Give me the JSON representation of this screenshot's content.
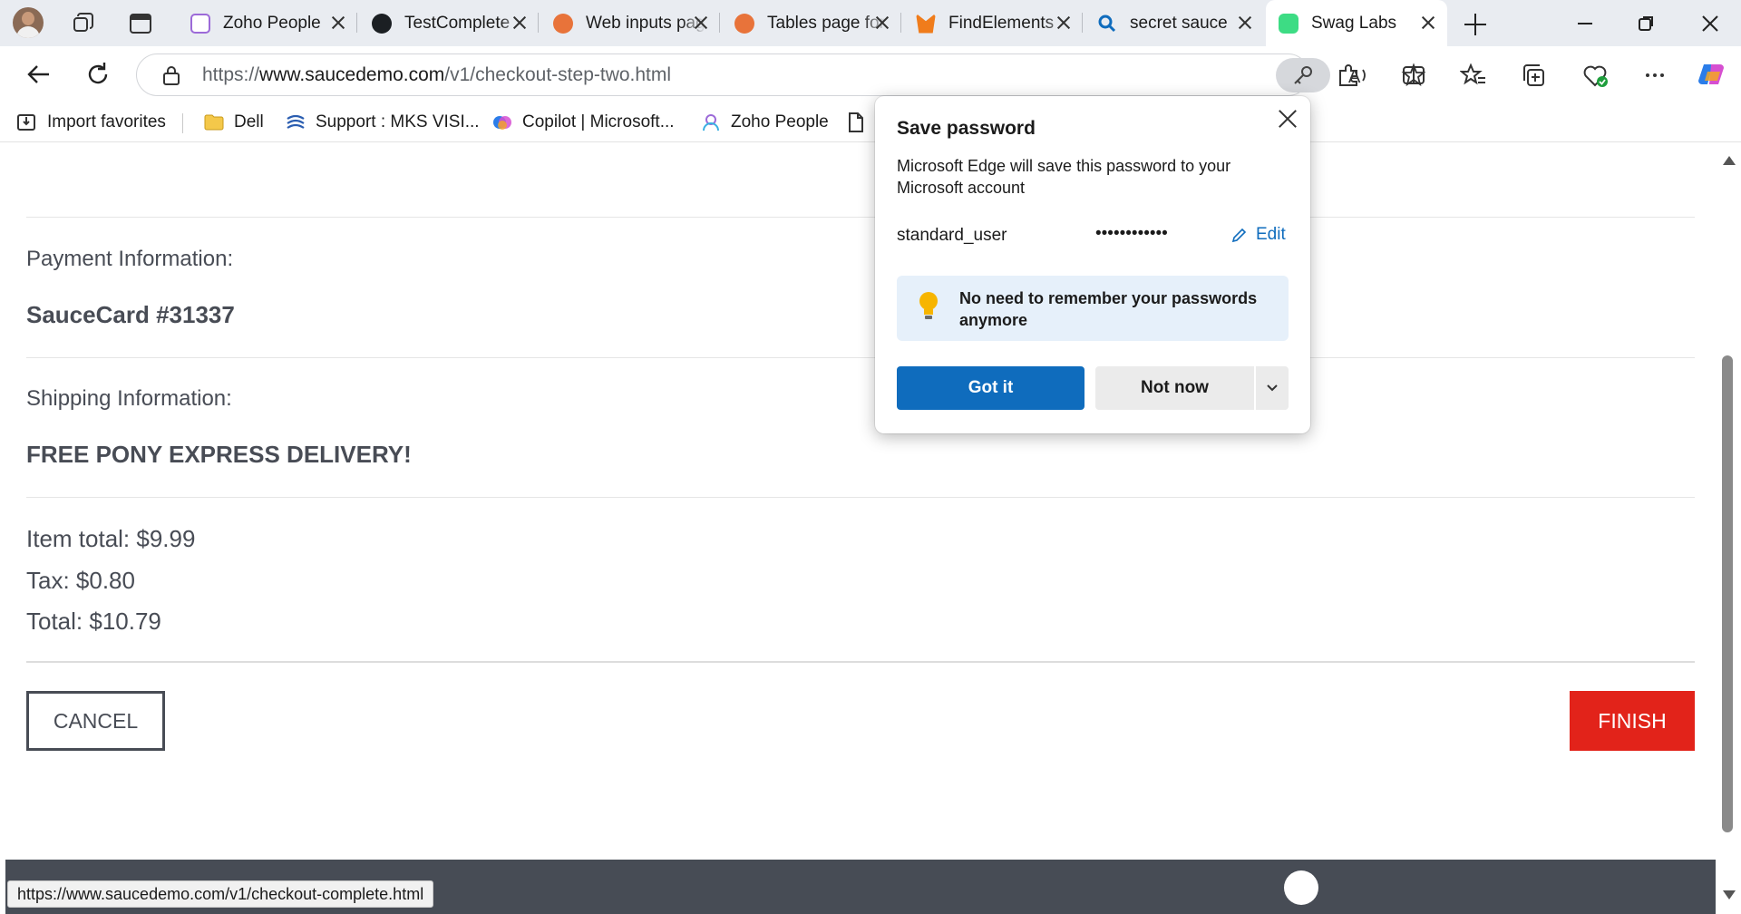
{
  "tabs": [
    {
      "title": "Zoho People",
      "favicon": "zoho-people-icon"
    },
    {
      "title": "TestComplete",
      "favicon": "github-icon"
    },
    {
      "title": "Web inputs page",
      "favicon": "robot-icon"
    },
    {
      "title": "Tables page for",
      "favicon": "robot-icon"
    },
    {
      "title": "FindElements",
      "favicon": "fox-icon"
    },
    {
      "title": "secret sauce",
      "favicon": "search-icon"
    },
    {
      "title": "Swag Labs",
      "favicon": "swag-labs-icon"
    }
  ],
  "address": {
    "scheme": "https://",
    "host": "www.saucedemo.com",
    "path": "/v1/checkout-step-two.html"
  },
  "favorites": [
    {
      "label": "Import favorites"
    },
    {
      "label": "Dell"
    },
    {
      "label": "Support : MKS VISI..."
    },
    {
      "label": "Copilot | Microsoft..."
    },
    {
      "label": "Zoho People"
    }
  ],
  "checkout": {
    "payment_label": "Payment Information:",
    "payment_value": "SauceCard #31337",
    "shipping_label": "Shipping Information:",
    "shipping_value": "FREE PONY EXPRESS DELIVERY!",
    "item_total": "Item total: $9.99",
    "tax": "Tax: $0.80",
    "total": "Total: $10.79",
    "cancel_label": "CANCEL",
    "finish_label": "FINISH"
  },
  "status_url": "https://www.saucedemo.com/v1/checkout-complete.html",
  "popup": {
    "title": "Save password",
    "description": "Microsoft Edge will save this password to your Microsoft account",
    "username": "standard_user",
    "password_mask": "••••••••••••",
    "edit_label": "Edit",
    "tip": "No need to remember your passwords anymore",
    "got_it_label": "Got it",
    "not_now_label": "Not now"
  },
  "colors": {
    "finish": "#e2231a",
    "primary": "#0f6cbd",
    "text": "#484c55",
    "footer": "#474c55"
  }
}
